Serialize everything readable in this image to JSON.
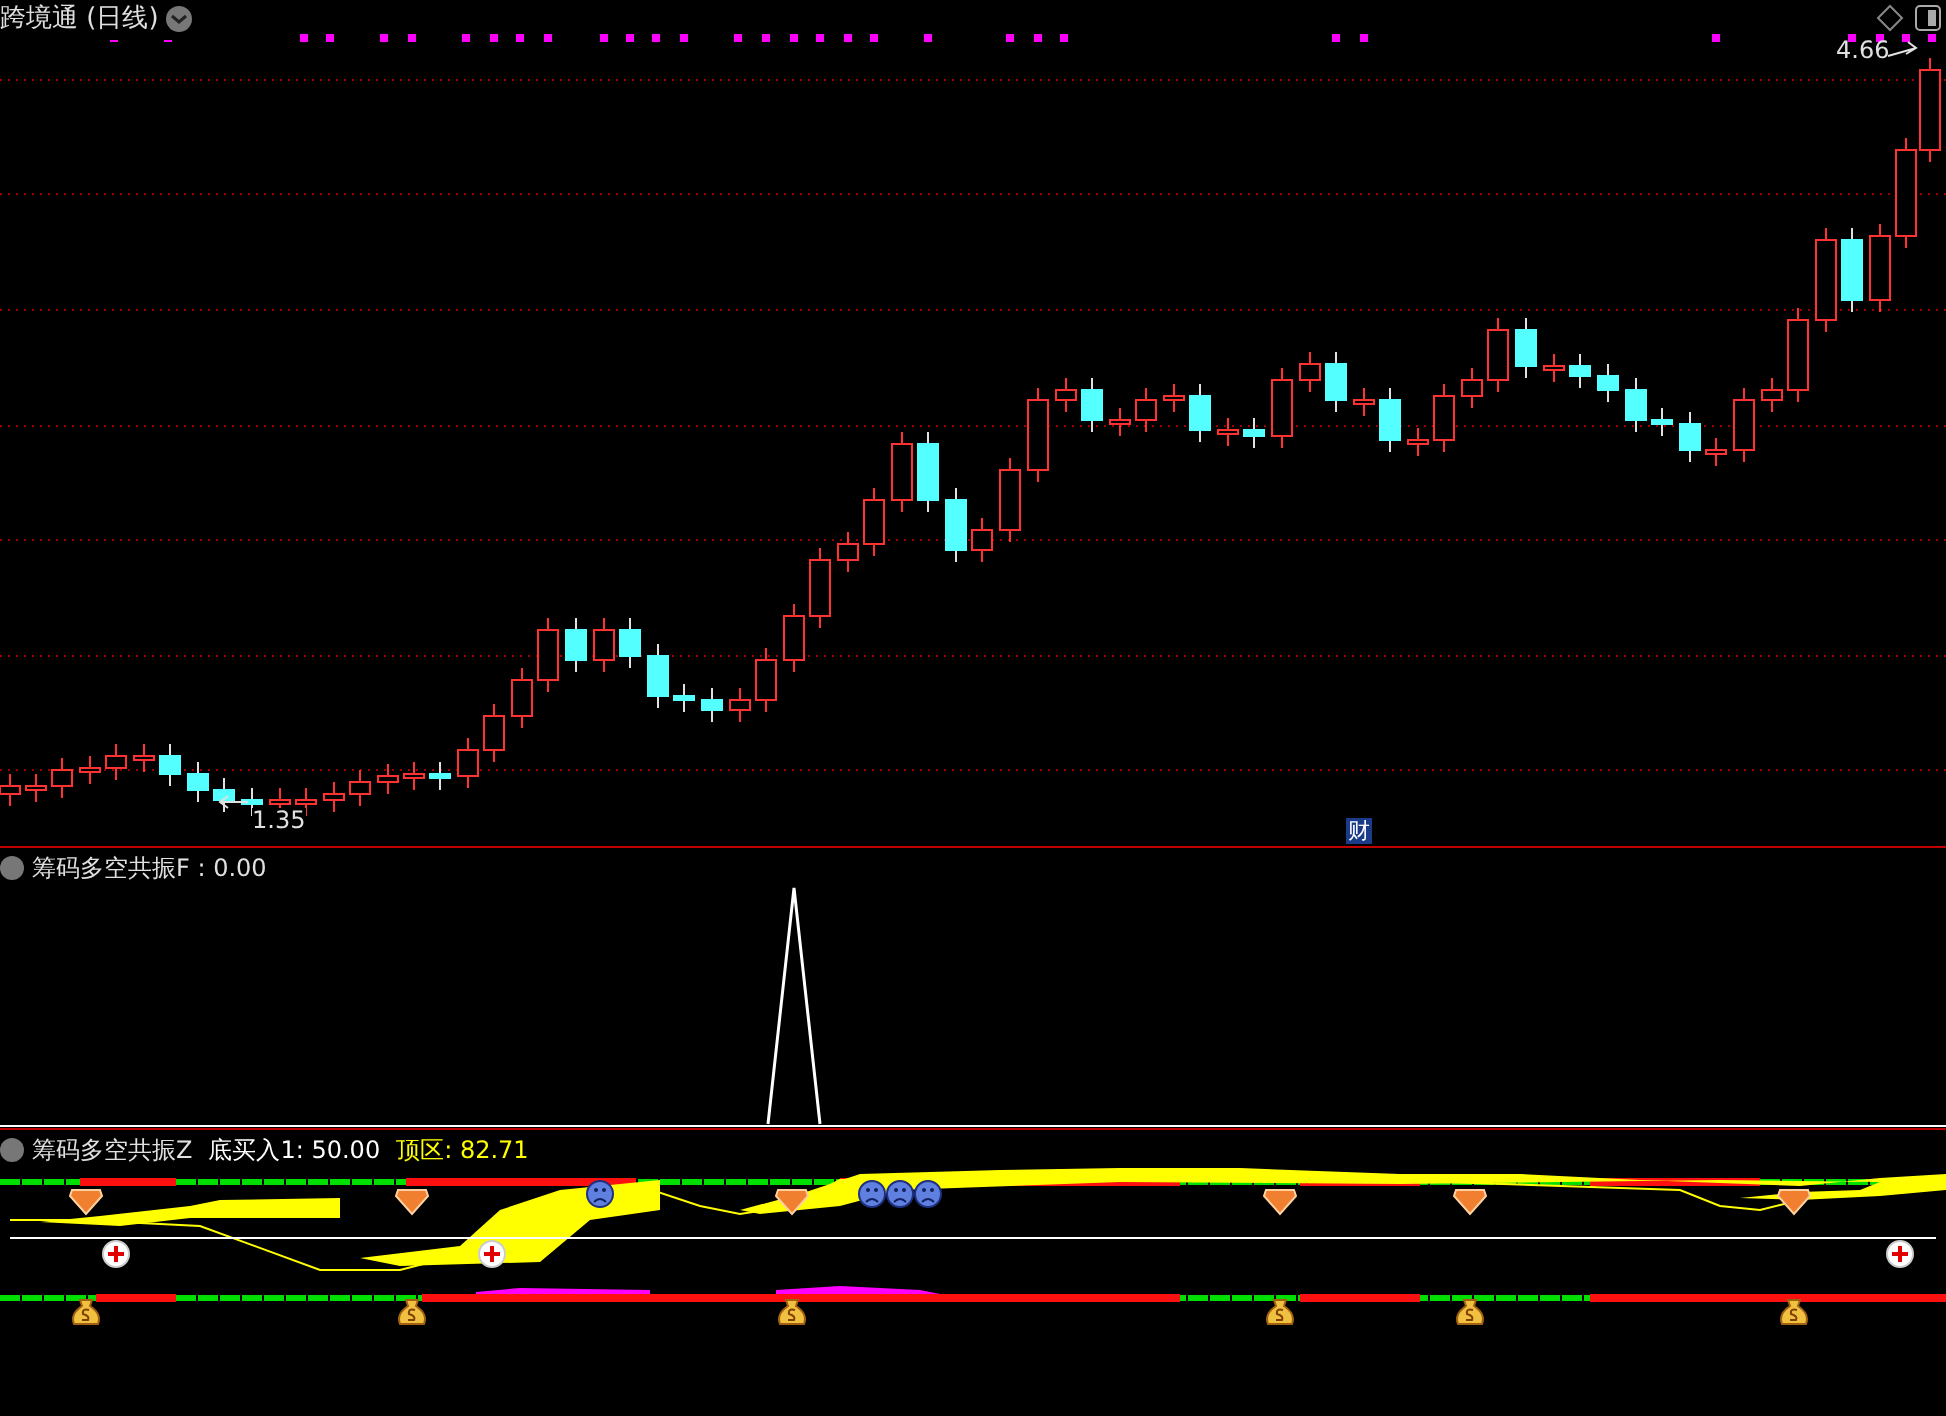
{
  "main_panel": {
    "title": "跨境通 (日线)",
    "high_label": "4.66",
    "low_label": "1.35",
    "news_badge": "财"
  },
  "f_panel": {
    "title": "筹码多空共振F : 0.00"
  },
  "z_panel": {
    "title": "筹码多空共振Z",
    "readings": [
      {
        "label": "底买入1: 50.00",
        "color": "#ffffff"
      },
      {
        "label": "顶区: 82.71",
        "color": "#ffff00"
      }
    ]
  }
}
